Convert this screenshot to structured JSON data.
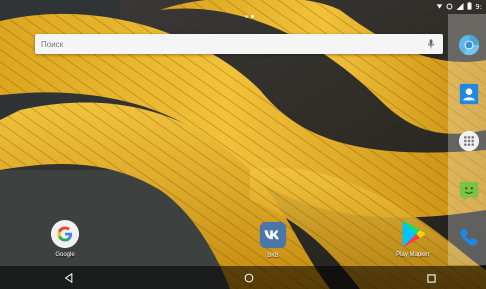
{
  "status_bar": {
    "time": "9:",
    "icons": [
      "notification-icon",
      "alarm-icon",
      "signal-icon",
      "battery-icon"
    ]
  },
  "home": {
    "page_indicator": {
      "pages": 2,
      "current": 2
    }
  },
  "search": {
    "placeholder": "Поиск",
    "mic_icon": "mic-icon"
  },
  "apps": [
    {
      "id": "google",
      "label": "Google",
      "icon": "google-icon"
    },
    {
      "id": "vk",
      "label": "ВКВ",
      "icon": "vk-icon"
    },
    {
      "id": "play",
      "label": "Play Маркет",
      "icon": "play-store-icon"
    }
  ],
  "dock": [
    {
      "id": "chrome",
      "icon": "chrome-icon"
    },
    {
      "id": "contacts",
      "icon": "contacts-icon"
    },
    {
      "id": "all-apps",
      "icon": "app-drawer-icon"
    },
    {
      "id": "messages",
      "icon": "messages-icon"
    },
    {
      "id": "phone",
      "icon": "phone-icon"
    }
  ],
  "navigation": {
    "back_icon": "back-icon",
    "home_icon": "home-icon",
    "recents_icon": "recents-icon"
  },
  "colors": {
    "rope": "#e6b422",
    "rope_shadow": "#b8860b",
    "nav_bg": "#000000",
    "search_bg": "#f5f5f5"
  }
}
